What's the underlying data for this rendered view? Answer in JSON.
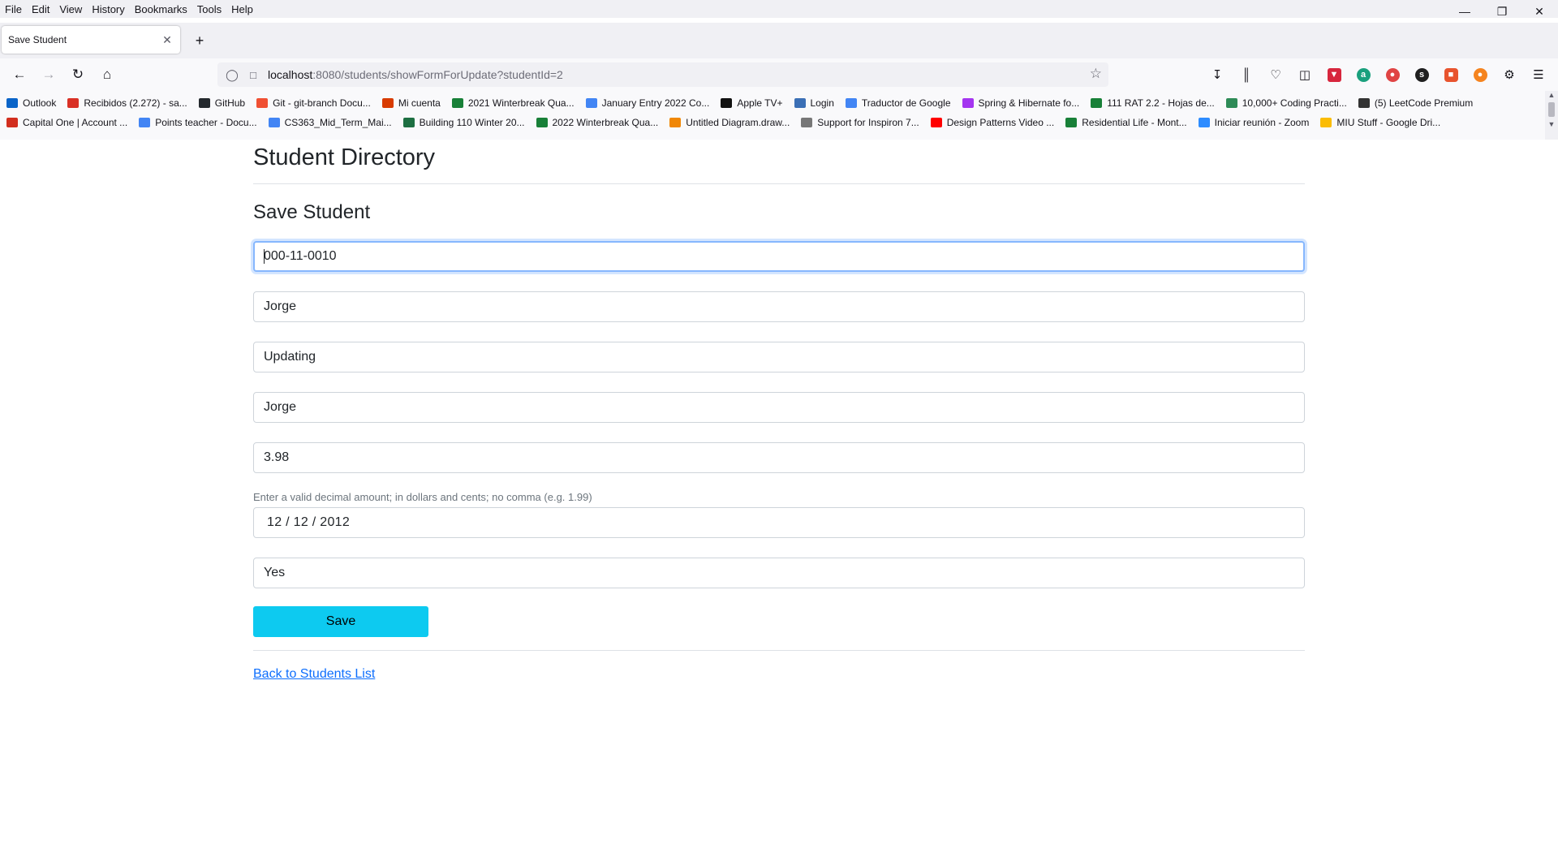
{
  "browser": {
    "menu": [
      "File",
      "Edit",
      "View",
      "History",
      "Bookmarks",
      "Tools",
      "Help"
    ],
    "tab_title": "Save Student",
    "url_host": "localhost",
    "url_rest": ":8080/students/showFormForUpdate?studentId=2",
    "bookmarks_row1": [
      {
        "label": "Outlook",
        "color": "#0a64c8"
      },
      {
        "label": "Recibidos (2.272) - sa...",
        "color": "#d93025"
      },
      {
        "label": "GitHub",
        "color": "#24292e"
      },
      {
        "label": "Git - git-branch Docu...",
        "color": "#f05033"
      },
      {
        "label": "Mi cuenta",
        "color": "#d83b01"
      },
      {
        "label": "2021 Winterbreak Qua...",
        "color": "#188038"
      },
      {
        "label": "January Entry 2022 Co...",
        "color": "#4285f4"
      },
      {
        "label": "Apple TV+",
        "color": "#111111"
      },
      {
        "label": "Login",
        "color": "#3b6fb6"
      },
      {
        "label": "Traductor de Google",
        "color": "#4285f4"
      },
      {
        "label": "Spring & Hibernate fo...",
        "color": "#a435f0"
      },
      {
        "label": "111 RAT 2.2 - Hojas de...",
        "color": "#188038"
      },
      {
        "label": "10,000+ Coding Practi...",
        "color": "#2e8b57"
      },
      {
        "label": "(5) LeetCode Premium",
        "color": "#333333"
      }
    ],
    "bookmarks_row2": [
      {
        "label": "Capital One | Account ...",
        "color": "#d22e1e"
      },
      {
        "label": "Points teacher - Docu...",
        "color": "#4285f4"
      },
      {
        "label": "CS363_Mid_Term_Mai...",
        "color": "#4285f4"
      },
      {
        "label": "Building 110 Winter 20...",
        "color": "#1d6f42"
      },
      {
        "label": "2022 Winterbreak Qua...",
        "color": "#188038"
      },
      {
        "label": "Untitled Diagram.draw...",
        "color": "#f08705"
      },
      {
        "label": "Support for Inspiron 7...",
        "color": "#777777"
      },
      {
        "label": "Design Patterns Video ...",
        "color": "#ff0000"
      },
      {
        "label": "Residential Life - Mont...",
        "color": "#188038"
      },
      {
        "label": "Iniciar reunión - Zoom",
        "color": "#2d8cff"
      },
      {
        "label": "MIU Stuff - Google Dri...",
        "color": "#fbbc04"
      }
    ]
  },
  "page": {
    "title": "Student Directory",
    "form_title": "Save Student",
    "fields": {
      "student_number": "000-11-0010",
      "first_name": "Jorge",
      "last_name": "Updating",
      "middle_name": "Jorge",
      "gpa": "3.98",
      "gpa_helper": "Enter a valid decimal amount; in dollars and cents; no comma (e.g. 1.99)",
      "date": "12 / 12 / 2012",
      "international": "Yes"
    },
    "save_label": "Save",
    "back_link": "Back to Students List"
  }
}
